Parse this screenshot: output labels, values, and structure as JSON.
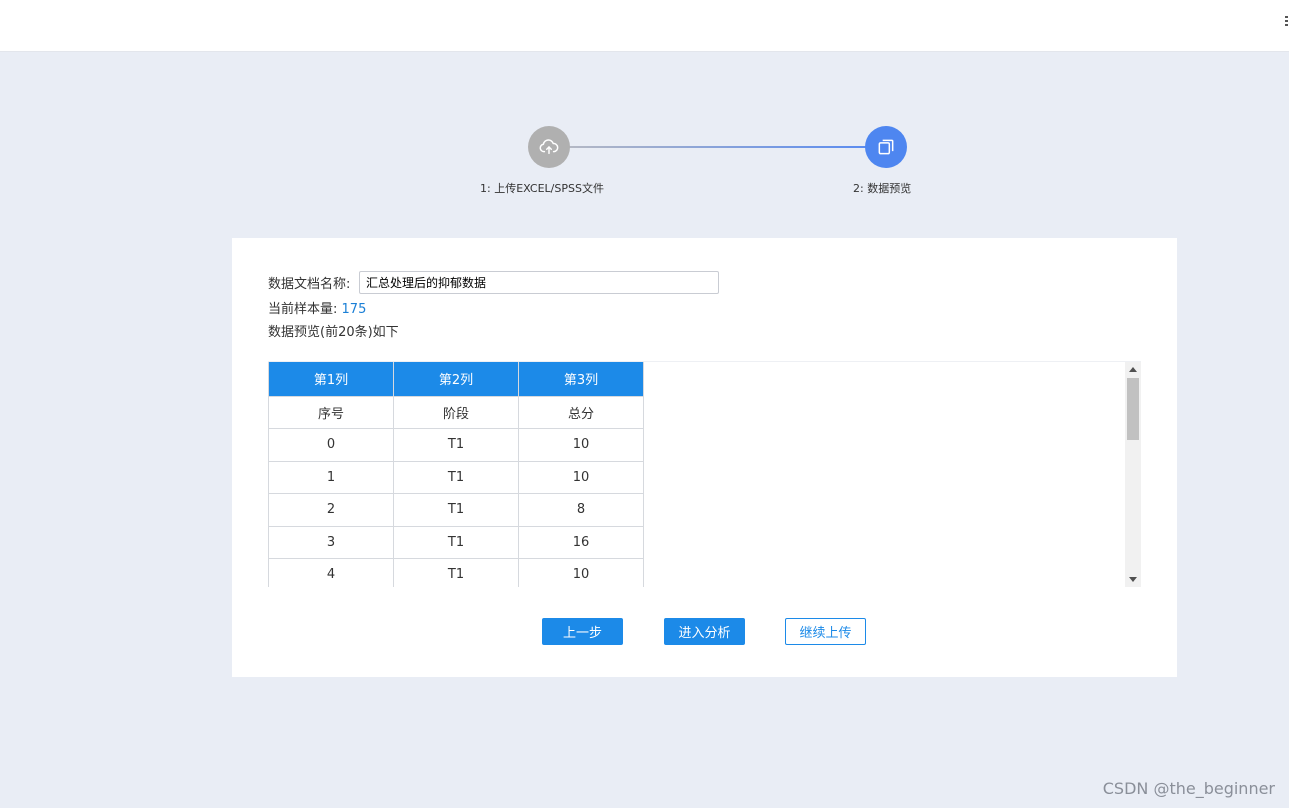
{
  "steps": [
    {
      "number": "1:",
      "label": "上传EXCEL/SPSS文件",
      "icon": "cloud-upload-icon",
      "color": "#b0b0b0"
    },
    {
      "number": "2:",
      "label": "数据预览",
      "icon": "copy-icon",
      "color": "#4e86f0"
    }
  ],
  "form": {
    "doc_name_label": "数据文档名称:",
    "doc_name_value": "汇总处理后的抑郁数据",
    "sample_label": "当前样本量:",
    "sample_value": "175",
    "preview_label": "数据预览(前20条)如下"
  },
  "table": {
    "headers": [
      "第1列",
      "第2列",
      "第3列"
    ],
    "rows": [
      [
        "序号",
        "阶段",
        "总分"
      ],
      [
        "0",
        "T1",
        "10"
      ],
      [
        "1",
        "T1",
        "10"
      ],
      [
        "2",
        "T1",
        "8"
      ],
      [
        "3",
        "T1",
        "16"
      ],
      [
        "4",
        "T1",
        "10"
      ]
    ]
  },
  "buttons": {
    "prev": "上一步",
    "analyze": "进入分析",
    "continue": "继续上传"
  },
  "colors": {
    "accent": "#1c8ae8",
    "sample_value": "#1a7fd6",
    "background": "#e9edf5"
  },
  "watermark": "CSDN @the_beginner"
}
